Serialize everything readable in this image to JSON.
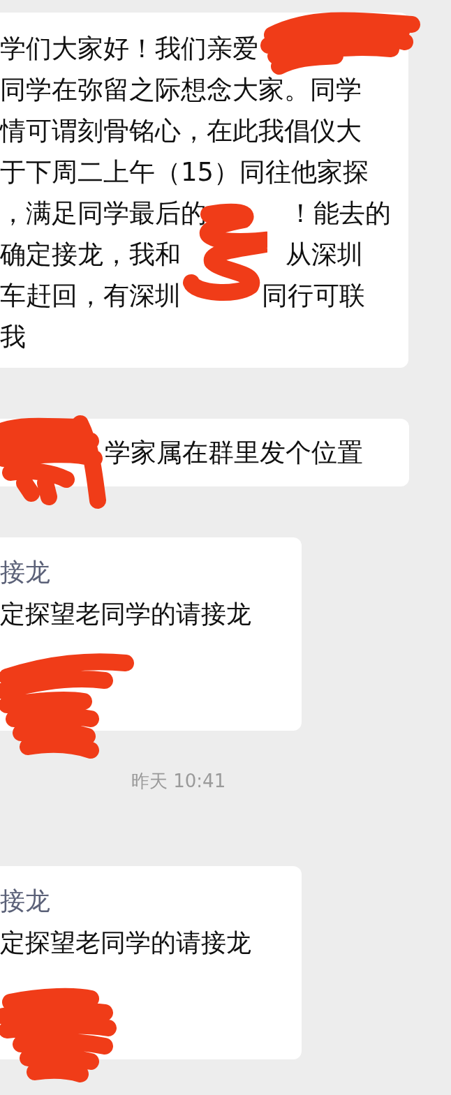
{
  "messages": [
    {
      "kind": "text",
      "lines": [
        [
          {
            "kind": "text",
            "text": "学们大家好！我们亲爱"
          },
          {
            "kind": "scribble"
          }
        ],
        [
          {
            "kind": "text",
            "text": "同学在弥留之际想念大家。同学"
          }
        ],
        [
          {
            "kind": "text",
            "text": "情可谓刻骨铭心，在此我倡仪大"
          }
        ],
        [
          {
            "kind": "text",
            "text": "于下周二上午（15）同往他家探"
          }
        ],
        [
          {
            "kind": "text",
            "text": "，满足同学最后的"
          },
          {
            "kind": "covered"
          },
          {
            "kind": "text",
            "text": "！能去的"
          }
        ],
        [
          {
            "kind": "text",
            "text": "确定接龙，我和"
          },
          {
            "kind": "scribble"
          },
          {
            "kind": "text",
            "text": "从深圳"
          }
        ],
        [
          {
            "kind": "text",
            "text": "车赶回，有深圳"
          },
          {
            "kind": "covered"
          },
          {
            "kind": "text",
            "text": "同行可联"
          }
        ],
        [
          {
            "kind": "text",
            "text": "我"
          }
        ]
      ]
    },
    {
      "kind": "text",
      "lines": [
        [
          {
            "kind": "scribble"
          },
          {
            "kind": "text",
            "text": "学家属在群里发个位置"
          }
        ]
      ]
    },
    {
      "kind": "solitaire",
      "title": "接龙",
      "body": "定探望老同学的请接龙",
      "lines": [
        [
          {
            "kind": "scribble"
          }
        ]
      ]
    },
    {
      "kind": "time",
      "text": "昨天 10:41"
    },
    {
      "kind": "solitaire",
      "title": "接龙",
      "body": "定探望老同学的请接龙",
      "lines": [
        [
          {
            "kind": "scribble"
          }
        ]
      ]
    }
  ]
}
